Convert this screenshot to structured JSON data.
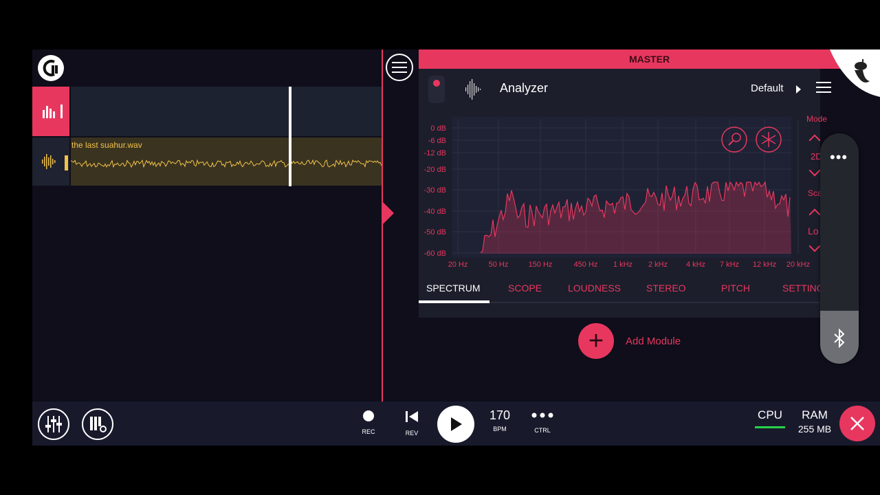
{
  "track": {
    "clip_name": "the last suahur.wav"
  },
  "master": {
    "title": "MASTER"
  },
  "analyzer": {
    "title": "Analyzer",
    "preset": "Default",
    "db_labels": [
      "0 dB",
      "-6 dB",
      "-12 dB",
      "-20 dB",
      "-30 dB",
      "-40 dB",
      "-50 dB",
      "-60 dB"
    ],
    "hz_labels": [
      "20 Hz",
      "50 Hz",
      "150 Hz",
      "450 Hz",
      "1 kHz",
      "2 kHz",
      "4 kHz",
      "7 kHz",
      "12 kHz",
      "20 kHz"
    ],
    "tabs": [
      "SPECTRUM",
      "SCOPE",
      "LOUDNESS",
      "STEREO",
      "PITCH",
      "SETTING"
    ],
    "active_tab": "SPECTRUM",
    "side": {
      "mode_label": "Mode",
      "mode_value": "2D",
      "scale_label": "Sca",
      "scale_value": "Lo"
    },
    "accent_color": "#e8375f"
  },
  "add_module": {
    "label": "Add Module"
  },
  "transport": {
    "rec": "REC",
    "rev": "REV",
    "bpm_value": "170",
    "bpm_label": "BPM",
    "ctrl_label": "CTRL",
    "cpu_label": "CPU",
    "ram_label": "RAM",
    "ram_value": "255 MB"
  }
}
